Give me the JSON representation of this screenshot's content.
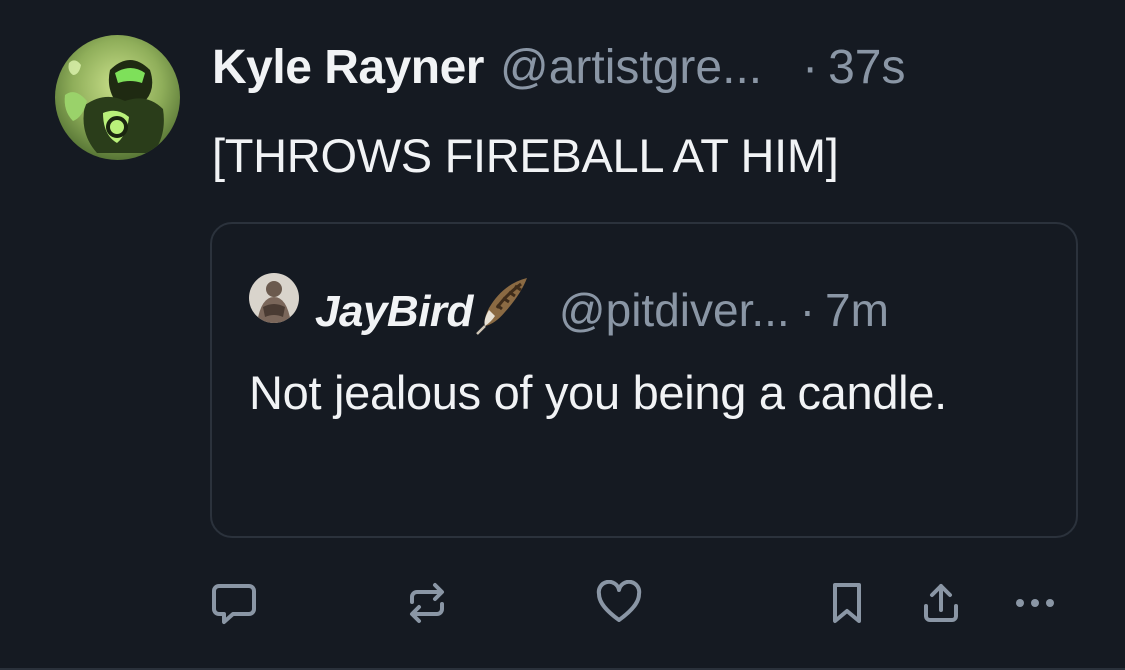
{
  "post": {
    "author_name": "Kyle Rayner",
    "author_handle": "@artistgre...",
    "separator": "·",
    "time": "37s",
    "text": "[THROWS FIREBALL AT HIM]"
  },
  "quote": {
    "author_name": "JayBird",
    "author_handle": "@pitdiver...",
    "separator": "·",
    "time": "7m",
    "text": "Not jealous of you being a candle."
  },
  "actions": [
    {
      "name": "reply",
      "icon": "speech-bubble-icon"
    },
    {
      "name": "repost",
      "icon": "repost-arrows-icon"
    },
    {
      "name": "like",
      "icon": "heart-icon"
    },
    {
      "name": "bookmark",
      "icon": "bookmark-icon"
    },
    {
      "name": "share",
      "icon": "share-icon"
    },
    {
      "name": "more",
      "icon": "ellipsis-icon"
    }
  ],
  "colors": {
    "background": "#151a22",
    "text": "#f1f3f5",
    "muted": "#8a96a5",
    "border": "#2b323c"
  }
}
